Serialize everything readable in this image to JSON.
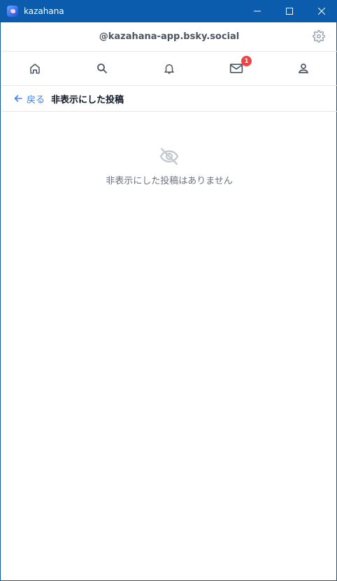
{
  "window": {
    "title": "kazahana",
    "controls": [
      "minimize",
      "maximize",
      "close"
    ]
  },
  "account": {
    "handle": "@kazahana-app.bsky.social"
  },
  "nav": {
    "items": [
      {
        "name": "home",
        "icon": "home-icon"
      },
      {
        "name": "search",
        "icon": "search-icon"
      },
      {
        "name": "notifications",
        "icon": "bell-icon"
      },
      {
        "name": "messages",
        "icon": "mail-icon",
        "badge": "1"
      },
      {
        "name": "profile",
        "icon": "person-icon"
      }
    ]
  },
  "subheader": {
    "back_label": "戻る",
    "title": "非表示にした投稿"
  },
  "empty": {
    "icon": "eye-off-icon",
    "message": "非表示にした投稿はありません"
  },
  "colors": {
    "titlebar": "#0b5cad",
    "accent": "#3b82f6",
    "badge": "#ef4444"
  }
}
